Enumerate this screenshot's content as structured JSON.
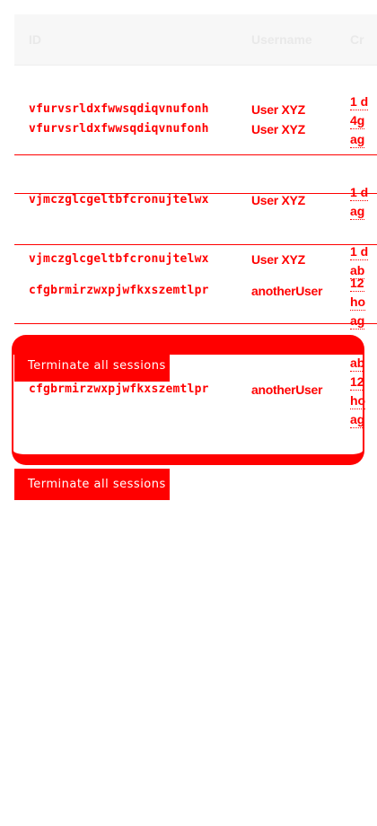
{
  "table": {
    "columns": [
      "ID",
      "Username",
      "Cr"
    ],
    "rows": [
      {
        "id": "vfurvsrldxfwwsqdiqvnufonh",
        "user": "User XYZ",
        "created": [
          "1 d",
          "4g",
          "ag"
        ]
      },
      {
        "id": "vfurvsrldxfwwsqdiqvnufonh",
        "user": "User XYZ",
        "created": []
      },
      {
        "id": "vjmczglcgeltbfcronujtelwx",
        "user": "User XYZ",
        "created": [
          "1 d",
          "ag"
        ]
      },
      {
        "id": "vjmczglcgeltbfcronujtelwx",
        "user": "User XYZ",
        "created": [
          "1 d",
          "ab"
        ]
      },
      {
        "id": "cfgbrmirzwxpjwfkxszemtlpr",
        "user": "anotherUser",
        "created": [
          "12",
          "ho",
          "ag"
        ]
      },
      {
        "id": "cfgbrmirzwxpjwfkxszemtlpr",
        "user": "anotherUser",
        "created": [
          "ab",
          "12",
          "ho",
          "ag"
        ]
      }
    ]
  },
  "buttons": {
    "terminate_overlay": "Terminate all sessions",
    "terminate_main": "Terminate all sessions"
  }
}
